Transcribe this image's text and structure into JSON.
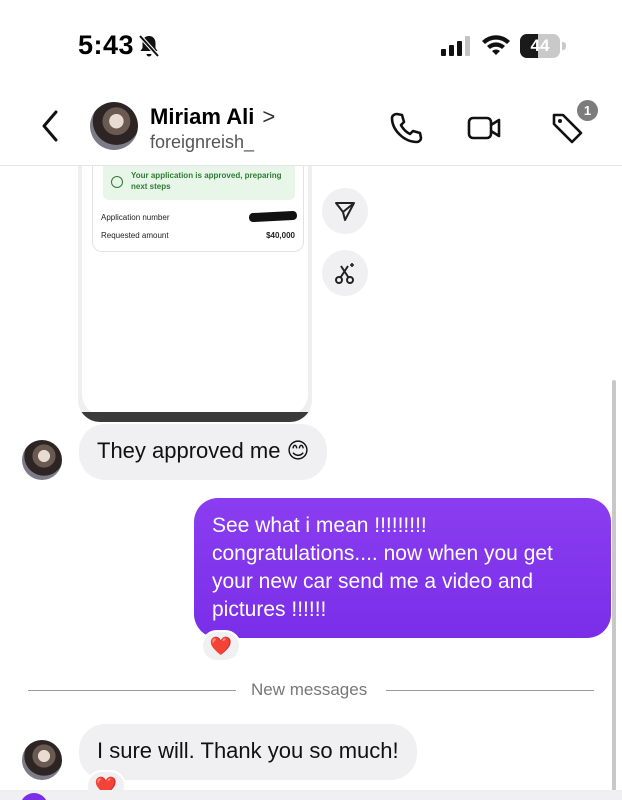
{
  "status_bar": {
    "time": "5:43",
    "battery": "44",
    "battery_level": 0.44,
    "icons": [
      "bell-slash-icon",
      "cellular-signal-icon",
      "wifi-icon",
      "battery-icon"
    ]
  },
  "header": {
    "name": "Miriam Ali",
    "chevron": ">",
    "handle": "foreignreish_",
    "tag_badge": "1",
    "icons": [
      "back-chevron-icon",
      "phone-icon",
      "video-camera-icon",
      "tag-icon"
    ]
  },
  "shared_screenshot": {
    "approval_text": "Your application is approved, preparing next steps",
    "application_number_label": "Application number",
    "requested_amount_label": "Requested amount",
    "requested_amount_value": "$40,000",
    "actions": [
      "share-send-icon",
      "ai-scissors-icon"
    ]
  },
  "messages": {
    "incoming_1": "They approved me 😊",
    "outgoing_1": "See what i mean !!!!!!!!! congratulations.... now when you get your new car send me a video and pictures !!!!!!",
    "outgoing_1_reaction": "❤️",
    "divider": "New messages",
    "incoming_2": "I sure will. Thank you so much!",
    "incoming_2_reaction": "❤️"
  },
  "colors": {
    "outgoing_bubble": "#7a2ee8",
    "incoming_bubble": "#f0f0f2",
    "approval_green": "#2e7d32"
  }
}
